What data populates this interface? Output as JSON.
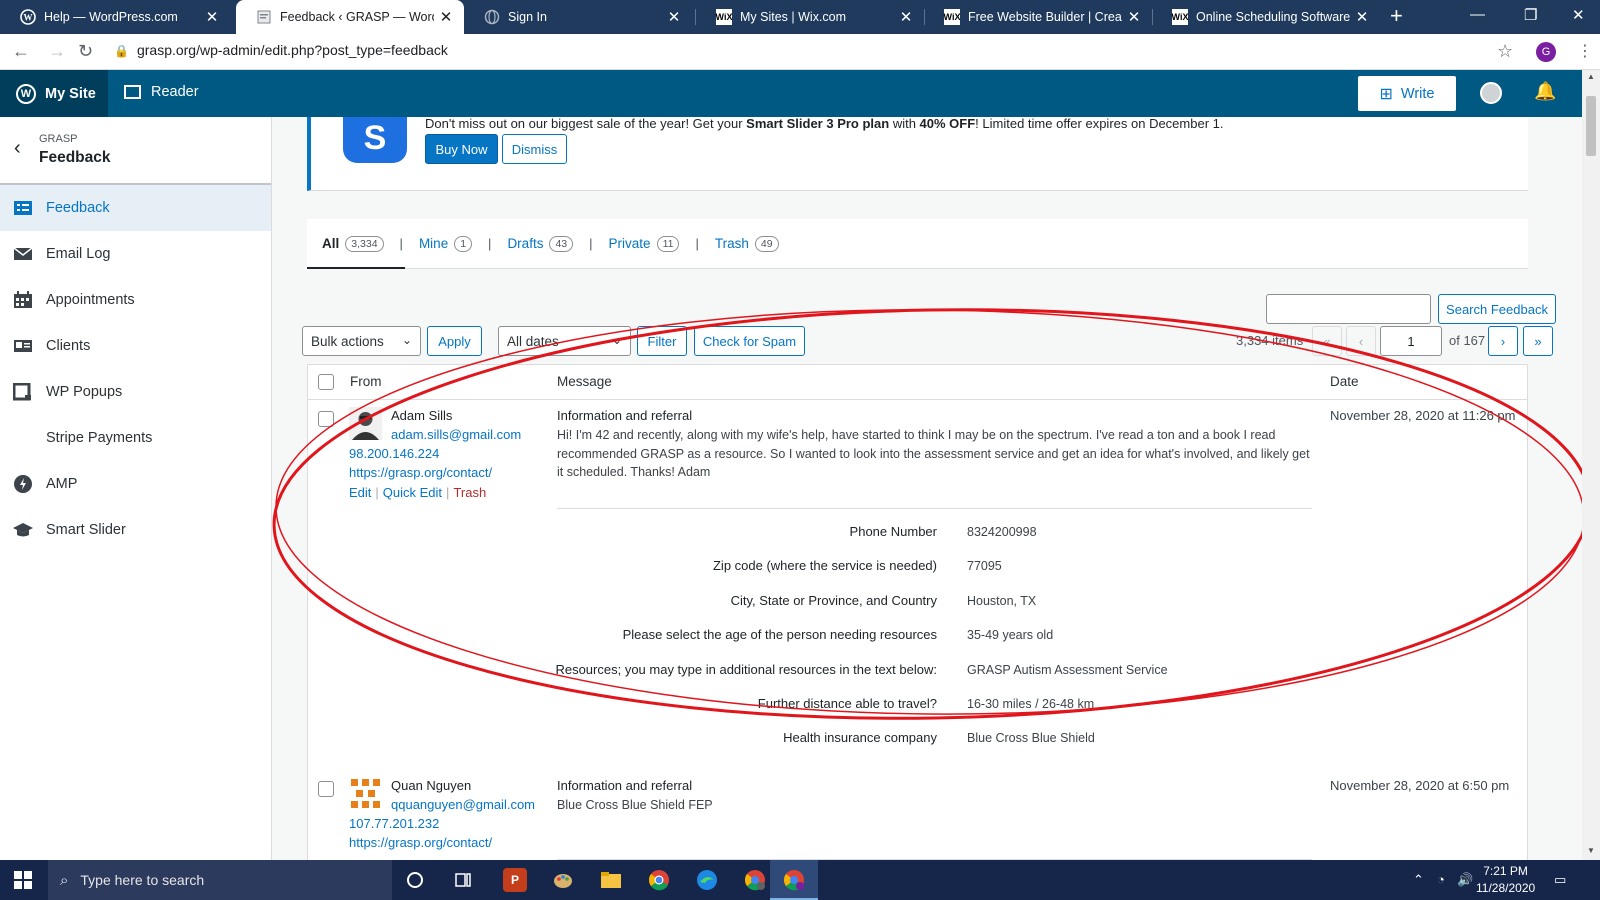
{
  "browser": {
    "tabs": [
      {
        "title": "Help — WordPress.com",
        "icon": "wordpress-icon",
        "active": false
      },
      {
        "title": "Feedback ‹ GRASP — WordPre",
        "icon": "page-icon",
        "active": true
      },
      {
        "title": "Sign In",
        "icon": "globe-icon",
        "active": false
      },
      {
        "title": "My Sites | Wix.com",
        "icon": "wix-icon",
        "active": false
      },
      {
        "title": "Free Website Builder | Create a",
        "icon": "wix-icon",
        "active": false
      },
      {
        "title": "Online Scheduling Software | A",
        "icon": "wix-icon",
        "active": false
      }
    ],
    "wix_label": "WiX",
    "url": "grasp.org/wp-admin/edit.php?post_type=feedback",
    "profile_initial": "G"
  },
  "masterbar": {
    "my_site": "My Site",
    "reader": "Reader",
    "write": "Write"
  },
  "sidebar": {
    "site": "GRASP",
    "title": "Feedback",
    "items": [
      {
        "label": "Feedback",
        "icon": "feedback-icon",
        "active": true
      },
      {
        "label": "Email Log",
        "icon": "email-icon",
        "active": false
      },
      {
        "label": "Appointments",
        "icon": "calendar-icon",
        "active": false
      },
      {
        "label": "Clients",
        "icon": "id-card-icon",
        "active": false
      },
      {
        "label": "WP Popups",
        "icon": "popup-icon",
        "active": false
      },
      {
        "label": "Stripe Payments",
        "icon": "",
        "active": false
      },
      {
        "label": "AMP",
        "icon": "amp-icon",
        "active": false
      },
      {
        "label": "Smart Slider",
        "icon": "graduation-cap-icon",
        "active": false
      }
    ]
  },
  "notice": {
    "logo_letter": "S",
    "text_pre": "Don't miss out on our biggest sale of the year! Get your ",
    "text_bold1": "Smart Slider 3 Pro plan",
    "text_mid": " with ",
    "text_bold2": "40% OFF",
    "text_post": "! Limited time offer expires on December 1.",
    "buy_now": "Buy Now",
    "dismiss": "Dismiss"
  },
  "filters": [
    {
      "label": "All",
      "count": "3,334"
    },
    {
      "label": "Mine",
      "count": "1"
    },
    {
      "label": "Drafts",
      "count": "43"
    },
    {
      "label": "Private",
      "count": "11"
    },
    {
      "label": "Trash",
      "count": "49"
    }
  ],
  "toolbar": {
    "search_button": "Search Feedback",
    "bulk_actions": "Bulk actions",
    "apply": "Apply",
    "all_dates": "All dates",
    "filter": "Filter",
    "check_spam": "Check for Spam",
    "items_count": "3,334 items",
    "first": "«",
    "prev": "‹",
    "current_page": "1",
    "of_pages": "of 167",
    "next": "›",
    "last": "»"
  },
  "table": {
    "col_from": "From",
    "col_message": "Message",
    "col_date": "Date",
    "row_actions": {
      "edit": "Edit",
      "quick_edit": "Quick Edit",
      "trash": "Trash"
    },
    "rows": [
      {
        "name": "Adam Sills",
        "email": "adam.sills@gmail.com",
        "ip": "98.200.146.224",
        "source": "https://grasp.org/contact/",
        "subject": "Information and referral",
        "message": "Hi! I'm 42 and recently, along with my wife's help, have started to think I may be on the spectrum. I've read a ton and a book I read recommended GRASP as a resource. So I wanted to look into the assessment service and get an idea for what's involved, and likely get it scheduled. Thanks! Adam",
        "date": "November 28, 2020 at 11:26 pm",
        "fields": [
          {
            "label": "Phone Number",
            "value": "8324200998"
          },
          {
            "label": "Zip code (where the service is needed)",
            "value": "77095"
          },
          {
            "label": "City, State or Province, and Country",
            "value": "Houston, TX"
          },
          {
            "label": "Please select the age of the person needing resources",
            "value": "35-49 years old"
          },
          {
            "label": "Resources; you may type in additional resources in the text below:",
            "value": "GRASP Autism Assessment Service"
          },
          {
            "label": "Further distance able to travel?",
            "value": "16-30 miles / 26-48 km"
          },
          {
            "label": "Health insurance company",
            "value": "Blue Cross Blue Shield"
          }
        ]
      },
      {
        "name": "Quan Nguyen",
        "email": "qquanguyen@gmail.com",
        "ip": "107.77.201.232",
        "source": "https://grasp.org/contact/",
        "subject": "Information and referral",
        "message": "Blue Cross Blue Shield FEP",
        "date": "November 28, 2020 at 6:50 pm"
      }
    ]
  },
  "taskbar": {
    "search_placeholder": "Type here to search",
    "apps": [
      "cortana-icon",
      "task-view-icon",
      "powerpoint-icon",
      "paint-icon",
      "file-explorer-icon",
      "chrome-icon",
      "edge-icon",
      "chrome-profile-icon",
      "chrome-profile-active-icon"
    ],
    "powerpoint_letter": "P",
    "time": "7:21 PM",
    "date": "11/28/2020"
  },
  "colors": {
    "accent": "#0675c4",
    "masterbar": "#005982",
    "annotation": "#e0161c"
  }
}
